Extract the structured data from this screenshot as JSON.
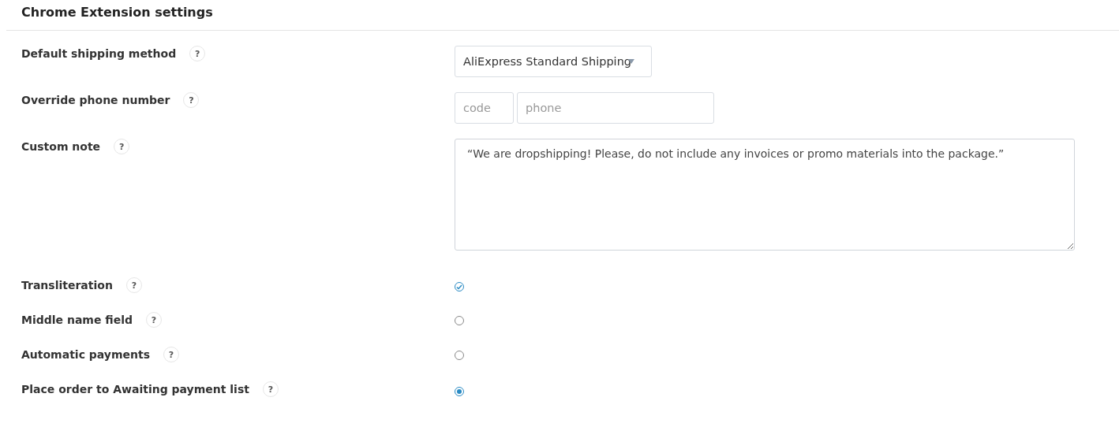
{
  "title": "Chrome Extension settings",
  "shipping": {
    "label": "Default shipping method",
    "help": "?",
    "value": "AliExpress Standard Shipping"
  },
  "phone": {
    "label": "Override phone number",
    "help": "?",
    "code_placeholder": "code",
    "phone_placeholder": "phone"
  },
  "note": {
    "label": "Custom note",
    "help": "?",
    "value": "“We are dropshipping! Please, do not include any invoices or promo materials into the package.”"
  },
  "options": [
    {
      "kind": "checkbox",
      "label": "Transliteration",
      "help": "?",
      "checked": true
    },
    {
      "kind": "radio",
      "label": "Middle name field",
      "help": "?",
      "checked": false
    },
    {
      "kind": "radio",
      "label": "Automatic payments",
      "help": "?",
      "checked": false
    },
    {
      "kind": "radio",
      "label": "Place order to Awaiting payment list",
      "help": "?",
      "checked": true
    }
  ]
}
